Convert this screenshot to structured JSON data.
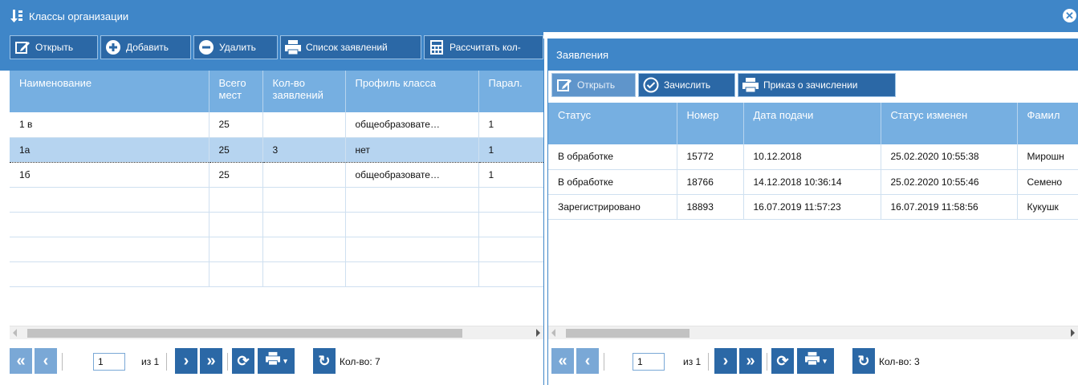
{
  "window": {
    "title": "Классы организации"
  },
  "left_toolbar": {
    "open": "Открыть",
    "add": "Добавить",
    "delete": "Удалить",
    "applications_list": "Список заявлений",
    "calculate": "Рассчитать кол-"
  },
  "classes_table": {
    "columns": [
      "Наименование",
      "Всего мест",
      "Кол-во заявлений",
      "Профиль класса",
      "Парал."
    ],
    "rows": [
      [
        "1 в",
        "25",
        "",
        "общеобразовате…",
        "1"
      ],
      [
        "1а",
        "25",
        "3",
        "нет",
        "1"
      ],
      [
        "1б",
        "25",
        "",
        "общеобразовате…",
        "1"
      ],
      [
        "",
        "",
        "",
        "",
        ""
      ],
      [
        "",
        "",
        "",
        "",
        ""
      ],
      [
        "",
        "",
        "",
        "",
        ""
      ],
      [
        "",
        "",
        "",
        "",
        ""
      ]
    ],
    "selected_row": 1
  },
  "left_pager": {
    "page": "1",
    "of_label": "из 1",
    "count": "Кол-во: 7"
  },
  "applications_panel": {
    "title": "Заявления",
    "toolbar": {
      "open": "Открыть",
      "enroll": "Зачислить",
      "enroll_order": "Приказ о зачислении"
    },
    "columns": [
      "Статус",
      "Номер",
      "Дата подачи",
      "Статус изменен",
      "Фамил"
    ],
    "rows": [
      [
        "В обработке",
        "15772",
        "10.12.2018",
        "25.02.2020 10:55:38",
        "Мирошн"
      ],
      [
        "В обработке",
        "18766",
        "14.12.2018 10:36:14",
        "25.02.2020 10:55:46",
        "Семено"
      ],
      [
        "Зарегистрировано",
        "18893",
        "16.07.2019 11:57:23",
        "16.07.2019 11:58:56",
        "Кукушк"
      ]
    ]
  },
  "right_pager": {
    "page": "1",
    "of_label": "из 1",
    "count": "Кол-во: 3"
  },
  "colors": {
    "accent": "#3f86c8",
    "button": "#2b68a6",
    "header": "#76afe1",
    "selection": "#b6d4f0"
  }
}
